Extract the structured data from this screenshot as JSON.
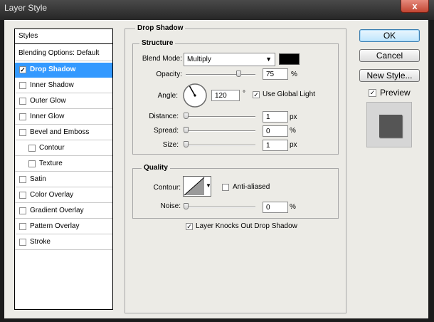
{
  "window": {
    "title": "Layer Style",
    "close_label": "x"
  },
  "styles_list": {
    "header": "Styles",
    "blending": "Blending Options: Default",
    "items": [
      {
        "label": "Drop Shadow",
        "checked": true,
        "selected": true
      },
      {
        "label": "Inner Shadow",
        "checked": false
      },
      {
        "label": "Outer Glow",
        "checked": false
      },
      {
        "label": "Inner Glow",
        "checked": false
      },
      {
        "label": "Bevel and Emboss",
        "checked": false
      },
      {
        "label": "Contour",
        "checked": false
      },
      {
        "label": "Texture",
        "checked": false
      },
      {
        "label": "Satin",
        "checked": false
      },
      {
        "label": "Color Overlay",
        "checked": false
      },
      {
        "label": "Gradient Overlay",
        "checked": false
      },
      {
        "label": "Pattern Overlay",
        "checked": false
      },
      {
        "label": "Stroke",
        "checked": false
      }
    ]
  },
  "drop_shadow": {
    "title": "Drop Shadow",
    "structure": {
      "title": "Structure",
      "blend_mode_label": "Blend Mode:",
      "blend_mode_value": "Multiply",
      "shadow_color": "#000000",
      "opacity_label": "Opacity:",
      "opacity_value": "75",
      "opacity_unit": "%",
      "opacity_fraction": 0.75,
      "angle_label": "Angle:",
      "angle_value": "120",
      "angle_unit": "°",
      "angle_degrees": 120,
      "global_light_label": "Use Global Light",
      "global_light_checked": true,
      "distance_label": "Distance:",
      "distance_value": "1",
      "distance_unit": "px",
      "spread_label": "Spread:",
      "spread_value": "0",
      "spread_unit": "%",
      "size_label": "Size:",
      "size_value": "1",
      "size_unit": "px"
    },
    "quality": {
      "title": "Quality",
      "contour_label": "Contour:",
      "anti_aliased_label": "Anti-aliased",
      "anti_aliased_checked": false,
      "noise_label": "Noise:",
      "noise_value": "0",
      "noise_unit": "%"
    },
    "knockout_label": "Layer Knocks Out Drop Shadow",
    "knockout_checked": true
  },
  "buttons": {
    "ok": "OK",
    "cancel": "Cancel",
    "new_style": "New Style..."
  },
  "preview": {
    "label": "Preview",
    "checked": true
  },
  "check_mark": "✓"
}
